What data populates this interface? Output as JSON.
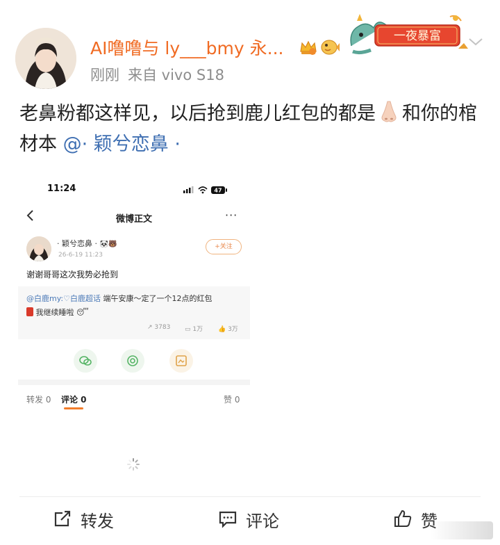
{
  "post": {
    "username": "AI噜噜与 ly___bmy 永...",
    "time": "刚刚",
    "source": "来自 vivo S18",
    "badges": [
      "crown-level-icon",
      "fish-icon"
    ],
    "banner_text": "一夜暴富",
    "text_part1": "老鼻粉都这样见，以后抢到鹿儿红包的都是",
    "text_part2": "和你的棺材本",
    "mention": "@· 颖兮恋鼻 ·",
    "emoji": "nose-emoji"
  },
  "embedded": {
    "clock": "11:24",
    "battery": "47",
    "title": "微博正文",
    "more": "···",
    "author": "· 颖兮恋鼻 ·",
    "date": "26-6-19 11:23",
    "follow_label": "+关注",
    "body": "谢谢哥哥这次我势必抢到",
    "quote_mention": "@白鹿my:",
    "quote_topic": "♡白鹿超话",
    "quote_text": " 端午安康～定了一个12点的红包",
    "quote_text2": " 我继续睡啦",
    "stats": {
      "reposts": "3783",
      "comments": "1万",
      "likes": "3万"
    },
    "tabs": {
      "repost": "转发 0",
      "comment": "评论 0",
      "like": "赞 0"
    }
  },
  "actions": {
    "repost": "转发",
    "comment": "评论",
    "like": "赞"
  },
  "colors": {
    "username": "#f06b23",
    "mention": "#3f6fb2",
    "accent": "#f27c2a"
  }
}
